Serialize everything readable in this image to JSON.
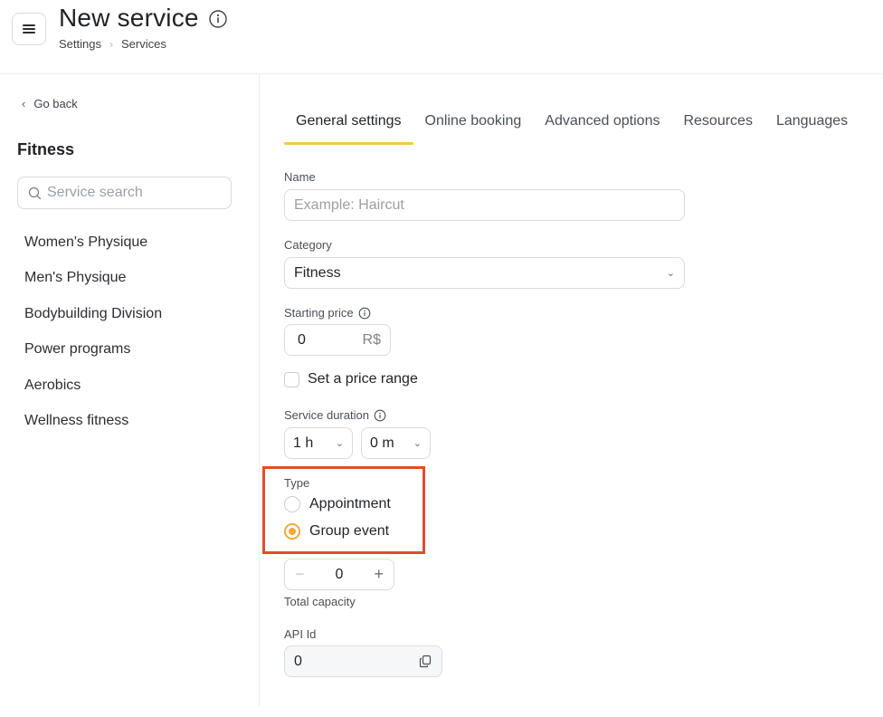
{
  "header": {
    "title": "New service",
    "breadcrumb": [
      "Settings",
      "Services"
    ]
  },
  "sidebar": {
    "go_back": "Go back",
    "title": "Fitness",
    "search_placeholder": "Service search",
    "items": [
      {
        "label": "Women's Physique"
      },
      {
        "label": "Men's Physique"
      },
      {
        "label": "Bodybuilding Division"
      },
      {
        "label": "Power programs"
      },
      {
        "label": "Aerobics"
      },
      {
        "label": "Wellness fitness"
      }
    ]
  },
  "tabs": [
    {
      "label": "General settings",
      "active": true
    },
    {
      "label": "Online booking"
    },
    {
      "label": "Advanced options"
    },
    {
      "label": "Resources"
    },
    {
      "label": "Languages"
    }
  ],
  "form": {
    "name_label": "Name",
    "name_placeholder": "Example: Haircut",
    "category_label": "Category",
    "category_value": "Fitness",
    "price_label": "Starting price",
    "price_value": "0",
    "currency": "R$",
    "price_range_label": "Set a price range",
    "duration_label": "Service duration",
    "duration_hours": "1 h",
    "duration_minutes": "0 m",
    "type_label": "Type",
    "type_options": [
      {
        "label": "Appointment",
        "checked": false
      },
      {
        "label": "Group event",
        "checked": true
      }
    ],
    "capacity_value": "0",
    "capacity_label": "Total capacity",
    "api_label": "API Id",
    "api_value": "0"
  },
  "colors": {
    "accent": "#f5c842",
    "radio_checked": "#f2a93b",
    "highlight": "#e14b2f"
  }
}
